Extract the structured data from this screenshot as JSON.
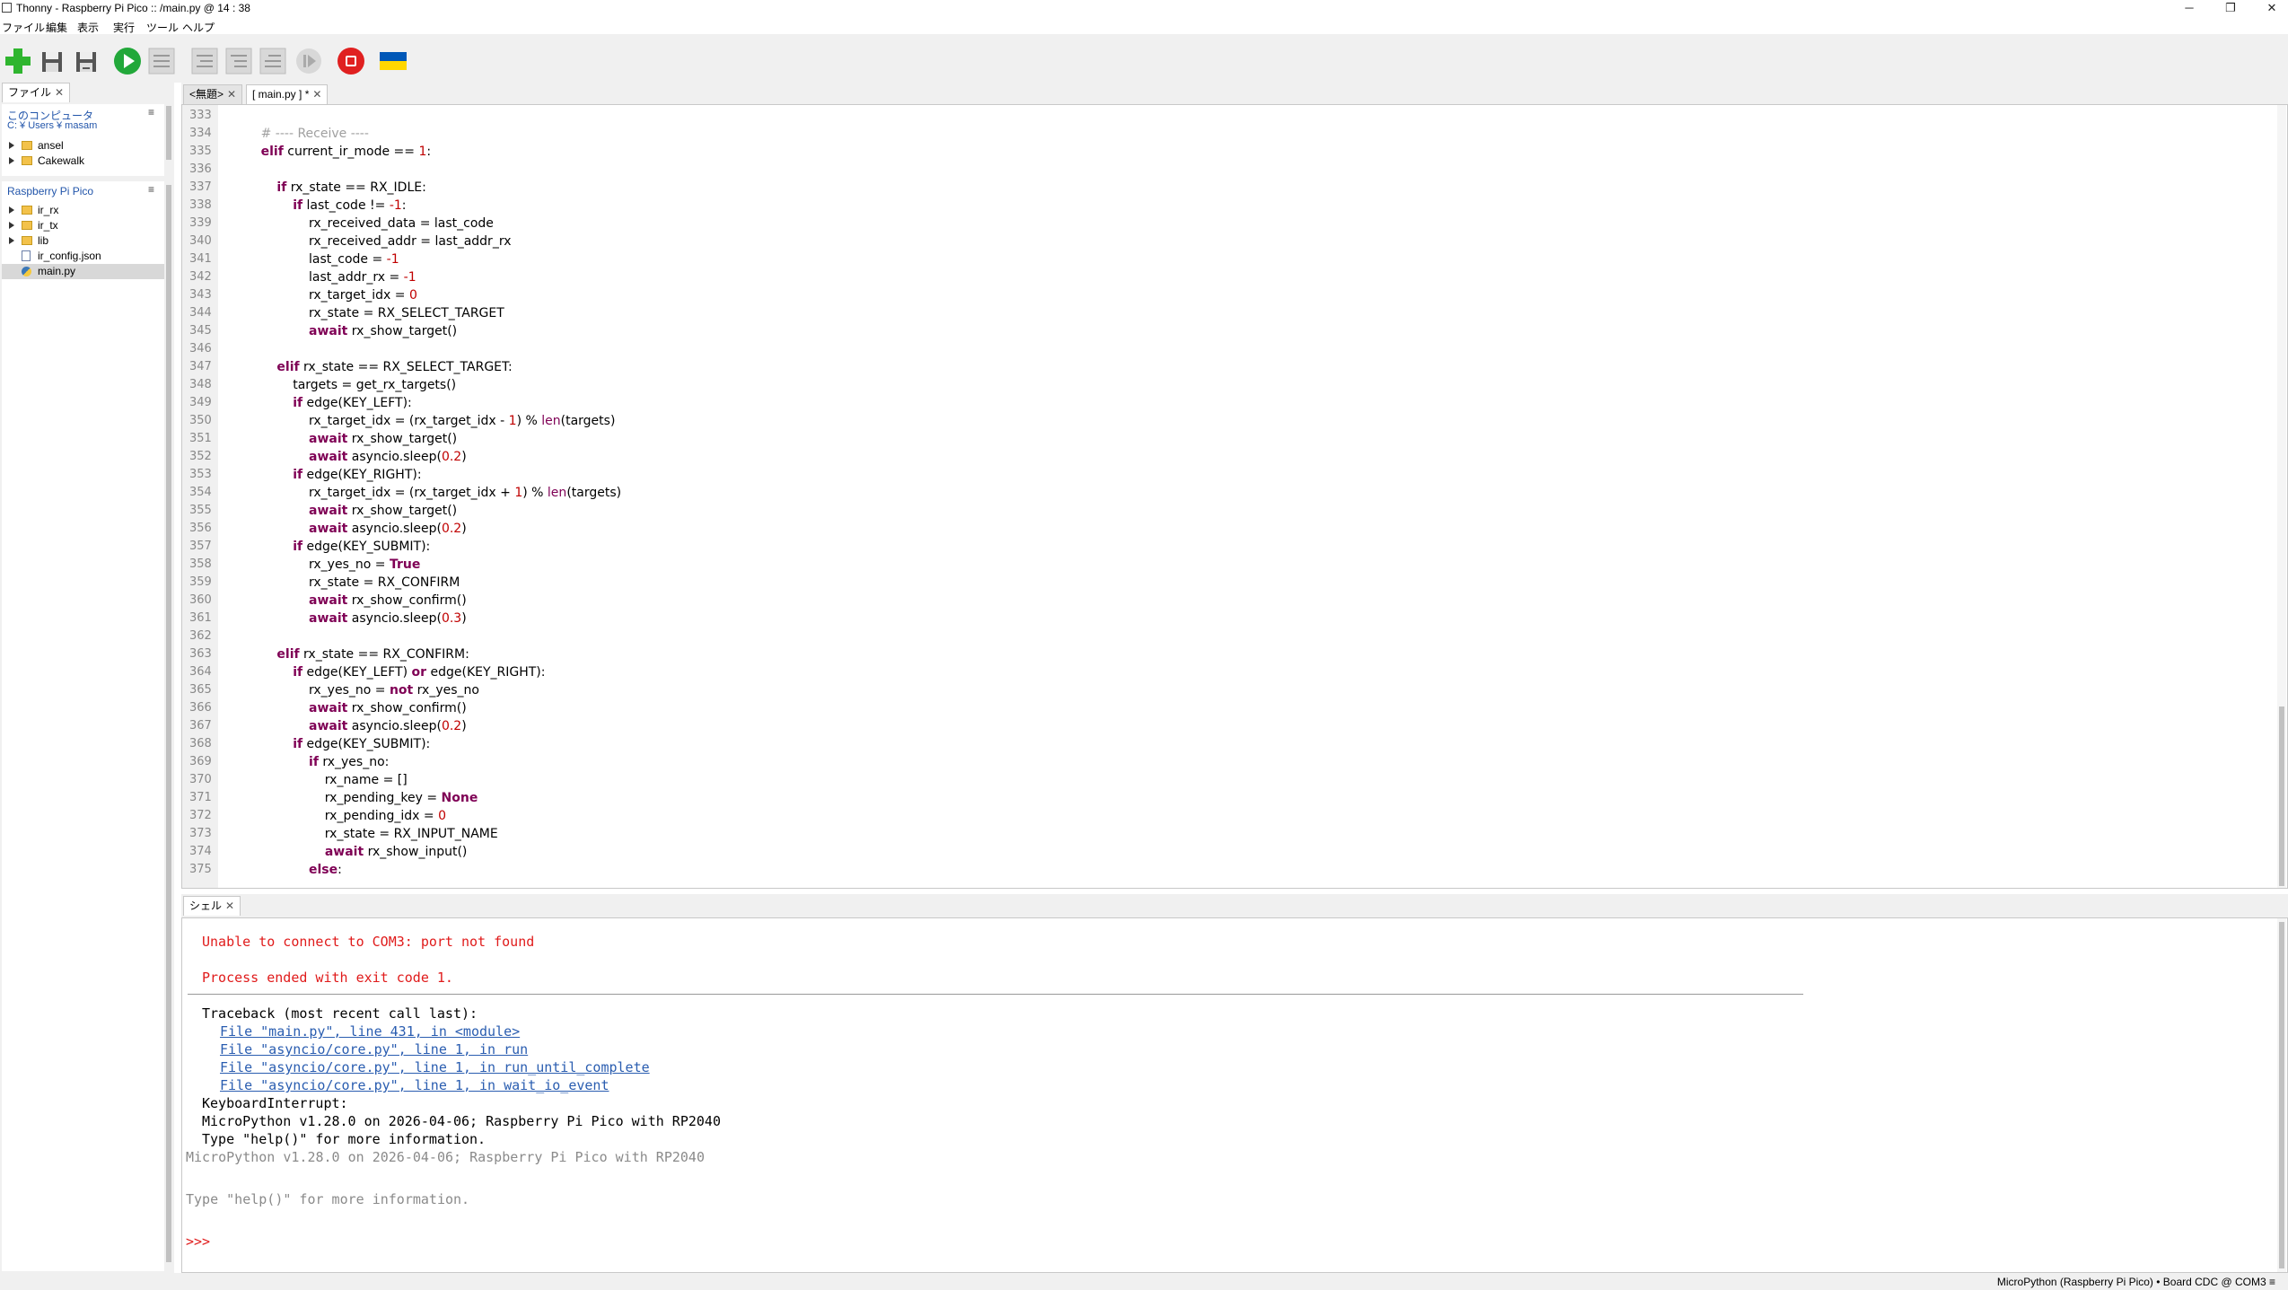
{
  "window": {
    "title": "Thonny  -  Raspberry Pi Pico :: /main.py  @  14 : 38",
    "minimize": "─",
    "maximize": "❐",
    "close": "✕"
  },
  "menu": [
    "ファイル",
    "編集",
    "表示",
    "実行",
    "ツール",
    "ヘルプ"
  ],
  "toolbar": {
    "icons": [
      "new-file-icon",
      "open-file-icon",
      "save-file-icon",
      "run-icon",
      "debug-icon",
      "step-over-icon",
      "step-into-icon",
      "step-out-icon",
      "resume-icon",
      "stop-icon",
      "ukraine-flag-icon"
    ],
    "colors": {
      "new": "#2fb52f",
      "run": "#22a83a",
      "stop": "#e02020",
      "flag_blue": "#0057b7",
      "flag_yellow": "#ffd700"
    }
  },
  "files": {
    "tab_label": "ファイル",
    "computer": {
      "header": "このコンピュータ",
      "path": "C: ¥ Users ¥ masam",
      "items": [
        {
          "label": "ansel",
          "type": "folder"
        },
        {
          "label": "Cakewalk",
          "type": "folder"
        }
      ]
    },
    "device": {
      "header": "Raspberry Pi Pico",
      "items": [
        {
          "label": "ir_rx",
          "type": "folder"
        },
        {
          "label": "ir_tx",
          "type": "folder"
        },
        {
          "label": "lib",
          "type": "folder"
        },
        {
          "label": "ir_config.json",
          "type": "file"
        },
        {
          "label": "main.py",
          "type": "python",
          "selected": true
        }
      ]
    }
  },
  "editor": {
    "tabs": [
      {
        "label": "<無題>",
        "active": false
      },
      {
        "label": "[ main.py ] *",
        "active": true
      }
    ],
    "lines": [
      {
        "n": "333",
        "html": ""
      },
      {
        "n": "334",
        "html": "        <span class='cm'># ---- Receive ----</span>"
      },
      {
        "n": "335",
        "html": "        <span class='kw'>elif</span> current_ir_mode == <span class='num'>1</span>:"
      },
      {
        "n": "336",
        "html": ""
      },
      {
        "n": "337",
        "html": "            <span class='kw'>if</span> rx_state == RX_IDLE:"
      },
      {
        "n": "338",
        "html": "                <span class='kw'>if</span> last_code != <span class='num'>-1</span>:"
      },
      {
        "n": "339",
        "html": "                    rx_received_data = last_code"
      },
      {
        "n": "340",
        "html": "                    rx_received_addr = last_addr_rx"
      },
      {
        "n": "341",
        "html": "                    last_code = <span class='num'>-1</span>"
      },
      {
        "n": "342",
        "html": "                    last_addr_rx = <span class='num'>-1</span>"
      },
      {
        "n": "343",
        "html": "                    rx_target_idx = <span class='num'>0</span>"
      },
      {
        "n": "344",
        "html": "                    rx_state = RX_SELECT_TARGET"
      },
      {
        "n": "345",
        "html": "                    <span class='kw'>await</span> rx_show_target()"
      },
      {
        "n": "346",
        "html": ""
      },
      {
        "n": "347",
        "html": "            <span class='kw'>elif</span> rx_state == RX_SELECT_TARGET:"
      },
      {
        "n": "348",
        "html": "                targets = get_rx_targets()"
      },
      {
        "n": "349",
        "html": "                <span class='kw'>if</span> edge(KEY_LEFT):"
      },
      {
        "n": "350",
        "html": "                    rx_target_idx = (rx_target_idx - <span class='num'>1</span>) % <span class='bi'>len</span>(targets)"
      },
      {
        "n": "351",
        "html": "                    <span class='kw'>await</span> rx_show_target()"
      },
      {
        "n": "352",
        "html": "                    <span class='kw'>await</span> asyncio.sleep(<span class='num'>0.2</span>)"
      },
      {
        "n": "353",
        "html": "                <span class='kw'>if</span> edge(KEY_RIGHT):"
      },
      {
        "n": "354",
        "html": "                    rx_target_idx = (rx_target_idx + <span class='num'>1</span>) % <span class='bi'>len</span>(targets)"
      },
      {
        "n": "355",
        "html": "                    <span class='kw'>await</span> rx_show_target()"
      },
      {
        "n": "356",
        "html": "                    <span class='kw'>await</span> asyncio.sleep(<span class='num'>0.2</span>)"
      },
      {
        "n": "357",
        "html": "                <span class='kw'>if</span> edge(KEY_SUBMIT):"
      },
      {
        "n": "358",
        "html": "                    rx_yes_no = <span class='kw'>True</span>"
      },
      {
        "n": "359",
        "html": "                    rx_state = RX_CONFIRM"
      },
      {
        "n": "360",
        "html": "                    <span class='kw'>await</span> rx_show_confirm()"
      },
      {
        "n": "361",
        "html": "                    <span class='kw'>await</span> asyncio.sleep(<span class='num'>0.3</span>)"
      },
      {
        "n": "362",
        "html": ""
      },
      {
        "n": "363",
        "html": "            <span class='kw'>elif</span> rx_state == RX_CONFIRM:"
      },
      {
        "n": "364",
        "html": "                <span class='kw'>if</span> edge(KEY_LEFT) <span class='kw'>or</span> edge(KEY_RIGHT):"
      },
      {
        "n": "365",
        "html": "                    rx_yes_no = <span class='kw'>not</span> rx_yes_no"
      },
      {
        "n": "366",
        "html": "                    <span class='kw'>await</span> rx_show_confirm()"
      },
      {
        "n": "367",
        "html": "                    <span class='kw'>await</span> asyncio.sleep(<span class='num'>0.2</span>)"
      },
      {
        "n": "368",
        "html": "                <span class='kw'>if</span> edge(KEY_SUBMIT):"
      },
      {
        "n": "369",
        "html": "                    <span class='kw'>if</span> rx_yes_no:"
      },
      {
        "n": "370",
        "html": "                        rx_name = []"
      },
      {
        "n": "371",
        "html": "                        rx_pending_key = <span class='kw'>None</span>"
      },
      {
        "n": "372",
        "html": "                        rx_pending_idx = <span class='num'>0</span>"
      },
      {
        "n": "373",
        "html": "                        rx_state = RX_INPUT_NAME"
      },
      {
        "n": "374",
        "html": "                        <span class='kw'>await</span> rx_show_input()"
      },
      {
        "n": "375",
        "html": "                    <span class='kw'>else</span>:"
      }
    ]
  },
  "shell": {
    "tab_label": "シェル",
    "lines": [
      {
        "text": "Unable to connect to COM3: port not found",
        "style": "err",
        "indent": 0
      },
      {
        "text": "",
        "style": "",
        "indent": 0
      },
      {
        "text": "Process ended with exit code 1.",
        "style": "err",
        "indent": 0
      },
      {
        "text": "",
        "style": "sep",
        "indent": 0
      },
      {
        "text": "Traceback (most recent call last):",
        "style": "",
        "indent": 0
      },
      {
        "text": "File \"main.py\", line 431, in <module>",
        "style": "link",
        "indent": 1
      },
      {
        "text": "File \"asyncio/core.py\", line 1, in run",
        "style": "link",
        "indent": 1
      },
      {
        "text": "File \"asyncio/core.py\", line 1, in run_until_complete",
        "style": "link",
        "indent": 1
      },
      {
        "text": "File \"asyncio/core.py\", line 1, in wait_io_event",
        "style": "link",
        "indent": 1
      },
      {
        "text": "KeyboardInterrupt:",
        "style": "",
        "indent": 0
      },
      {
        "text": "MicroPython v1.28.0 on 2026-04-06; Raspberry Pi Pico with RP2040",
        "style": "",
        "indent": 0
      },
      {
        "text": "Type \"help()\" for more information.",
        "style": "",
        "indent": 0
      },
      {
        "text": "MicroPython v1.28.0 on 2026-04-06; Raspberry Pi Pico with RP2040",
        "style": "gray",
        "indent": -1
      },
      {
        "text": "",
        "style": "",
        "indent": 0
      },
      {
        "text": "Type \"help()\" for more information.",
        "style": "gray",
        "indent": -1
      },
      {
        "text": "",
        "style": "",
        "indent": 0
      },
      {
        "text": ">>>",
        "style": "err",
        "indent": -1
      }
    ]
  },
  "status": {
    "text": "MicroPython (Raspberry Pi Pico)  •  Board CDC @ COM3  ≡"
  }
}
